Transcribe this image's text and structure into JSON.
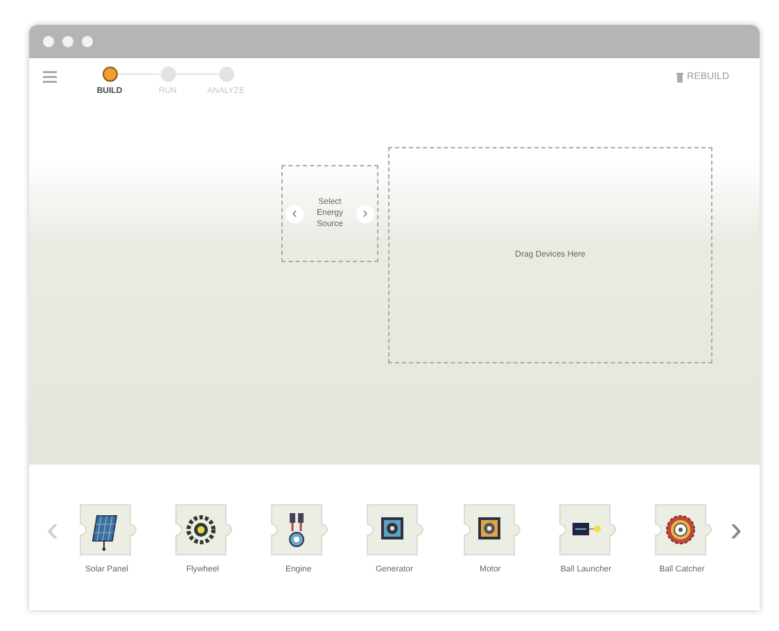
{
  "steps": [
    {
      "label": "BUILD",
      "selected": true
    },
    {
      "label": "RUN",
      "selected": false
    },
    {
      "label": "ANALYZE",
      "selected": false
    }
  ],
  "rebuild_button": {
    "label": "REBUILD"
  },
  "energy_selector": {
    "prev": "‹",
    "label": "Select Energy Source",
    "next": "›"
  },
  "drop_zone": {
    "label": "Drag Devices Here"
  },
  "palette": {
    "prev": "‹",
    "next": "›",
    "devices": [
      {
        "kind": "solar",
        "label": "Solar Panel"
      },
      {
        "kind": "flywheel",
        "label": "Flywheel"
      },
      {
        "kind": "engine",
        "label": "Engine"
      },
      {
        "kind": "generator",
        "label": "Generator"
      },
      {
        "kind": "motor",
        "label": "Motor"
      },
      {
        "kind": "launcher",
        "label": "Ball Launcher"
      },
      {
        "kind": "catcher",
        "label": "Ball Catcher"
      }
    ]
  }
}
